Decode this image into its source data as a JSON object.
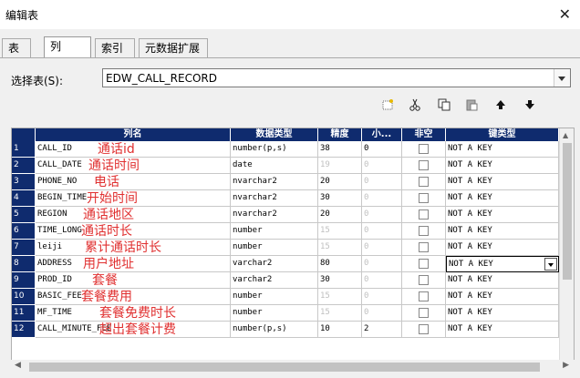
{
  "window": {
    "title": "编辑表",
    "close_glyph": "✕"
  },
  "tabs": [
    {
      "label": "表",
      "active": false
    },
    {
      "label": "列",
      "active": true
    },
    {
      "label": "索引",
      "active": false
    },
    {
      "label": "元数据扩展",
      "active": false
    }
  ],
  "table_select": {
    "label": "选择表(S):",
    "value": "EDW_CALL_RECORD"
  },
  "toolbar": {
    "new_icon": "new-row-icon",
    "cut_icon": "scissors-icon",
    "copy_icon": "copy-icon",
    "paste_icon": "paste-icon",
    "up_icon": "arrow-up-icon",
    "down_icon": "arrow-down-icon"
  },
  "grid": {
    "headers": {
      "name": "列名",
      "type": "数据类型",
      "precision": "精度",
      "scale": "小...",
      "nullable": "非空",
      "key_type": "键类型"
    },
    "rows": [
      {
        "num": "1",
        "name": "CALL_ID",
        "type": "number(p,s)",
        "precision": "38",
        "scale": "0",
        "key": "NOT A KEY",
        "note": "通话id",
        "dim_p": false,
        "dim_s": false
      },
      {
        "num": "2",
        "name": "CALL_DATE",
        "type": "date",
        "precision": "19",
        "scale": "0",
        "key": "NOT A KEY",
        "note": "通话时间",
        "dim_p": true,
        "dim_s": true
      },
      {
        "num": "3",
        "name": "PHONE_NO",
        "type": "nvarchar2",
        "precision": "20",
        "scale": "0",
        "key": "NOT A KEY",
        "note": "电话",
        "dim_p": false,
        "dim_s": true
      },
      {
        "num": "4",
        "name": "BEGIN_TIME",
        "type": "nvarchar2",
        "precision": "30",
        "scale": "0",
        "key": "NOT A KEY",
        "note": "开始时间",
        "dim_p": false,
        "dim_s": true
      },
      {
        "num": "5",
        "name": "REGION",
        "type": "nvarchar2",
        "precision": "20",
        "scale": "0",
        "key": "NOT A KEY",
        "note": "通话地区",
        "dim_p": false,
        "dim_s": true
      },
      {
        "num": "6",
        "name": "TIME_LONG",
        "type": "number",
        "precision": "15",
        "scale": "0",
        "key": "NOT A KEY",
        "note": "通话时长",
        "dim_p": true,
        "dim_s": true
      },
      {
        "num": "7",
        "name": "leiji",
        "type": "number",
        "precision": "15",
        "scale": "0",
        "key": "NOT A KEY",
        "note": "累计通话时长",
        "dim_p": true,
        "dim_s": true
      },
      {
        "num": "8",
        "name": "ADDRESS",
        "type": "varchar2",
        "precision": "80",
        "scale": "0",
        "key": "NOT A KEY",
        "note": "用户地址",
        "dim_p": false,
        "dim_s": true,
        "selected_dropdown": true
      },
      {
        "num": "9",
        "name": "PROD_ID",
        "type": "varchar2",
        "precision": "30",
        "scale": "0",
        "key": "NOT A KEY",
        "note": "套餐",
        "dim_p": false,
        "dim_s": true
      },
      {
        "num": "10",
        "name": "BASIC_FEE",
        "type": "number",
        "precision": "15",
        "scale": "0",
        "key": "NOT A KEY",
        "note": "套餐费用",
        "dim_p": true,
        "dim_s": true
      },
      {
        "num": "11",
        "name": "MF_TIME",
        "type": "number",
        "precision": "15",
        "scale": "0",
        "key": "NOT A KEY",
        "note": "套餐免费时长",
        "dim_p": true,
        "dim_s": true
      },
      {
        "num": "12",
        "name": "CALL_MINUTE_FEE",
        "type": "number(p,s)",
        "precision": "10",
        "scale": "2",
        "key": "NOT A KEY",
        "note": "超出套餐计费",
        "dim_p": false,
        "dim_s": false
      }
    ]
  }
}
